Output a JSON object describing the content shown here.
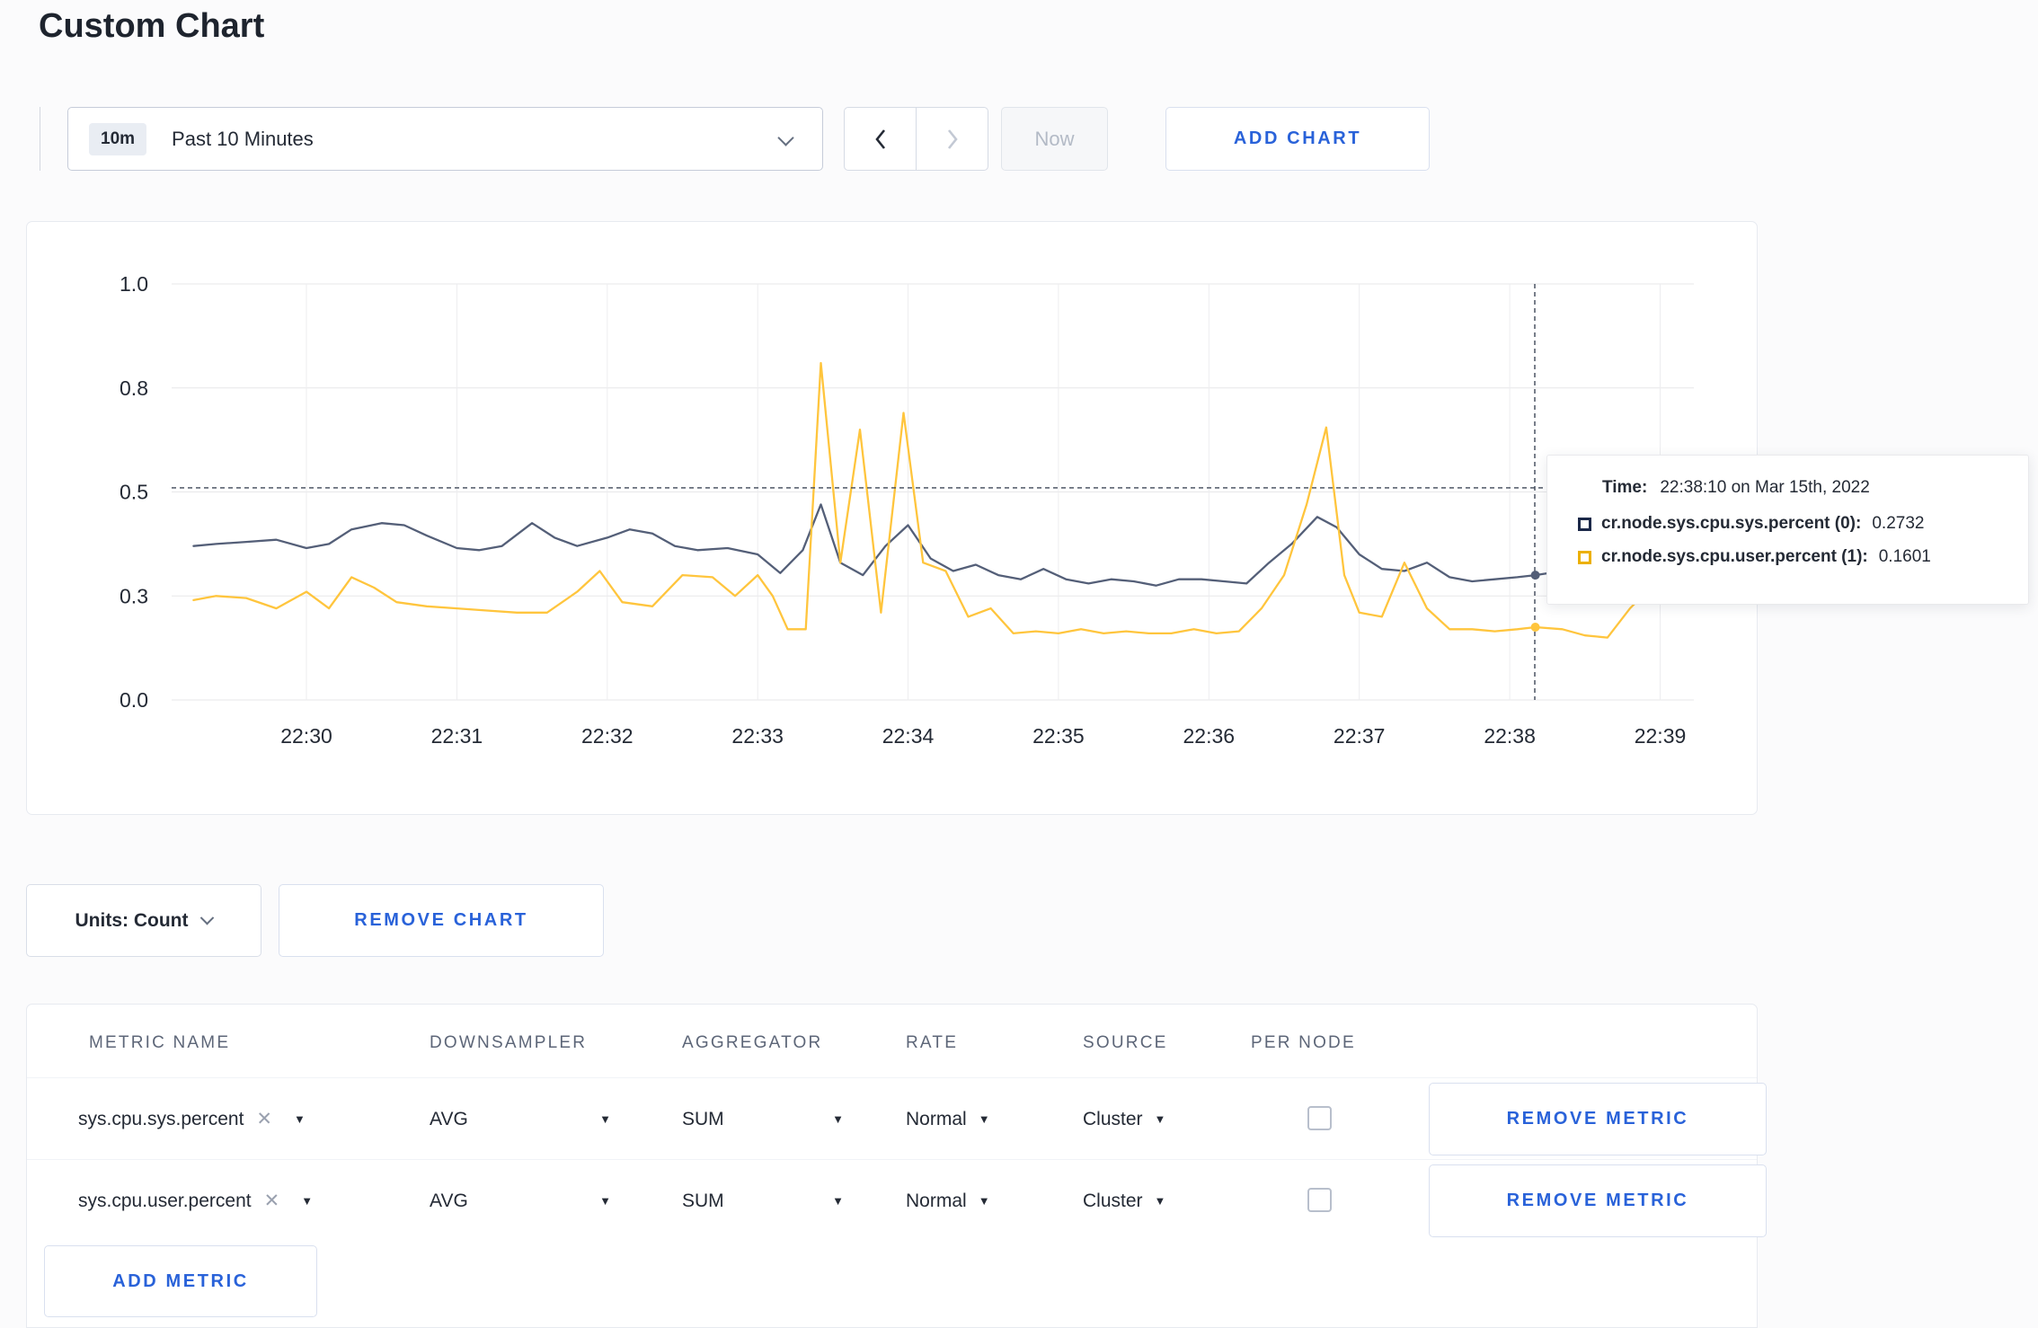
{
  "colors": {
    "accent_blue": "#2962d9",
    "series_sys_line": "#545f78",
    "series_user_line": "#ffc53d",
    "legend_sys_swatch": "#1b2848",
    "legend_user_swatch": "#ecb000"
  },
  "page": {
    "title": "Custom Chart"
  },
  "toolbar": {
    "time_range_badge": "10m",
    "time_range_label": "Past 10 Minutes",
    "now_label": "Now",
    "add_chart_label": "ADD CHART"
  },
  "chart_controls": {
    "units_label": "Units: Count",
    "remove_chart_label": "REMOVE CHART"
  },
  "metrics_table": {
    "headers": [
      "METRIC NAME",
      "DOWNSAMPLER",
      "AGGREGATOR",
      "RATE",
      "SOURCE",
      "PER NODE"
    ],
    "rows": [
      {
        "name": "sys.cpu.sys.percent",
        "remove_x": "✕",
        "downsampler": "AVG",
        "aggregator": "SUM",
        "rate": "Normal",
        "source": "Cluster",
        "per_node_checked": false
      },
      {
        "name": "sys.cpu.user.percent",
        "remove_x": "✕",
        "downsampler": "AVG",
        "aggregator": "SUM",
        "rate": "Normal",
        "source": "Cluster",
        "per_node_checked": false
      }
    ],
    "remove_metric_label": "REMOVE METRIC",
    "add_metric_label": "ADD METRIC"
  },
  "chart_data": {
    "type": "line",
    "title": "",
    "xlabel": "",
    "ylabel": "",
    "ylim": [
      0,
      1
    ],
    "xlim_minutes_after_2200": [
      29.104,
      39.224
    ],
    "grid": true,
    "y_ticks": [
      0,
      0.25,
      0.5,
      0.75,
      1
    ],
    "y_tick_labels": [
      "0.0",
      "0.3",
      "0.5",
      "0.8",
      "1.0"
    ],
    "x_ticks": [
      {
        "x": 30,
        "label": "22:30"
      },
      {
        "x": 31,
        "label": "22:31"
      },
      {
        "x": 32,
        "label": "22:32"
      },
      {
        "x": 33,
        "label": "22:33"
      },
      {
        "x": 34,
        "label": "22:34"
      },
      {
        "x": 35,
        "label": "22:35"
      },
      {
        "x": 36,
        "label": "22:36"
      },
      {
        "x": 37,
        "label": "22:37"
      },
      {
        "x": 38,
        "label": "22:38"
      },
      {
        "x": 39,
        "label": "22:39"
      }
    ],
    "series": [
      {
        "name": "cr.node.sys.cpu.sys.percent",
        "color": "#545f78",
        "points": [
          [
            29.25,
            0.37
          ],
          [
            29.4,
            0.375
          ],
          [
            29.6,
            0.38
          ],
          [
            29.8,
            0.385
          ],
          [
            30.0,
            0.365
          ],
          [
            30.15,
            0.375
          ],
          [
            30.3,
            0.41
          ],
          [
            30.5,
            0.425
          ],
          [
            30.65,
            0.42
          ],
          [
            30.8,
            0.395
          ],
          [
            31.0,
            0.365
          ],
          [
            31.15,
            0.36
          ],
          [
            31.3,
            0.37
          ],
          [
            31.5,
            0.425
          ],
          [
            31.65,
            0.39
          ],
          [
            31.8,
            0.37
          ],
          [
            32.0,
            0.39
          ],
          [
            32.15,
            0.41
          ],
          [
            32.3,
            0.4
          ],
          [
            32.45,
            0.37
          ],
          [
            32.6,
            0.36
          ],
          [
            32.8,
            0.365
          ],
          [
            33.0,
            0.35
          ],
          [
            33.15,
            0.305
          ],
          [
            33.3,
            0.36
          ],
          [
            33.42,
            0.47
          ],
          [
            33.55,
            0.33
          ],
          [
            33.7,
            0.3
          ],
          [
            33.85,
            0.37
          ],
          [
            34.0,
            0.42
          ],
          [
            34.15,
            0.34
          ],
          [
            34.3,
            0.31
          ],
          [
            34.45,
            0.325
          ],
          [
            34.6,
            0.3
          ],
          [
            34.75,
            0.29
          ],
          [
            34.9,
            0.315
          ],
          [
            35.05,
            0.29
          ],
          [
            35.2,
            0.28
          ],
          [
            35.35,
            0.29
          ],
          [
            35.5,
            0.285
          ],
          [
            35.65,
            0.275
          ],
          [
            35.8,
            0.29
          ],
          [
            35.95,
            0.29
          ],
          [
            36.1,
            0.285
          ],
          [
            36.25,
            0.28
          ],
          [
            36.4,
            0.33
          ],
          [
            36.55,
            0.375
          ],
          [
            36.72,
            0.44
          ],
          [
            36.85,
            0.415
          ],
          [
            37.0,
            0.35
          ],
          [
            37.15,
            0.315
          ],
          [
            37.3,
            0.31
          ],
          [
            37.45,
            0.33
          ],
          [
            37.6,
            0.295
          ],
          [
            37.75,
            0.285
          ],
          [
            37.9,
            0.29
          ],
          [
            38.05,
            0.295
          ],
          [
            38.17,
            0.3
          ],
          [
            38.35,
            0.31
          ],
          [
            38.5,
            0.315
          ],
          [
            38.65,
            0.3
          ],
          [
            38.8,
            0.3
          ],
          [
            38.95,
            0.305
          ],
          [
            39.1,
            0.31
          ]
        ]
      },
      {
        "name": "cr.node.sys.cpu.user.percent",
        "color": "#ffc53d",
        "points": [
          [
            29.25,
            0.24
          ],
          [
            29.4,
            0.25
          ],
          [
            29.6,
            0.245
          ],
          [
            29.8,
            0.22
          ],
          [
            30.0,
            0.26
          ],
          [
            30.15,
            0.22
          ],
          [
            30.3,
            0.295
          ],
          [
            30.45,
            0.27
          ],
          [
            30.6,
            0.235
          ],
          [
            30.8,
            0.225
          ],
          [
            31.0,
            0.22
          ],
          [
            31.2,
            0.215
          ],
          [
            31.4,
            0.21
          ],
          [
            31.6,
            0.21
          ],
          [
            31.8,
            0.26
          ],
          [
            31.95,
            0.31
          ],
          [
            32.1,
            0.235
          ],
          [
            32.3,
            0.225
          ],
          [
            32.5,
            0.3
          ],
          [
            32.7,
            0.295
          ],
          [
            32.85,
            0.25
          ],
          [
            33.0,
            0.3
          ],
          [
            33.1,
            0.25
          ],
          [
            33.2,
            0.17
          ],
          [
            33.32,
            0.17
          ],
          [
            33.42,
            0.81
          ],
          [
            33.55,
            0.33
          ],
          [
            33.68,
            0.65
          ],
          [
            33.82,
            0.21
          ],
          [
            33.97,
            0.69
          ],
          [
            34.1,
            0.33
          ],
          [
            34.25,
            0.31
          ],
          [
            34.4,
            0.2
          ],
          [
            34.55,
            0.22
          ],
          [
            34.7,
            0.16
          ],
          [
            34.85,
            0.165
          ],
          [
            35.0,
            0.16
          ],
          [
            35.15,
            0.17
          ],
          [
            35.3,
            0.16
          ],
          [
            35.45,
            0.165
          ],
          [
            35.6,
            0.16
          ],
          [
            35.75,
            0.16
          ],
          [
            35.9,
            0.17
          ],
          [
            36.05,
            0.16
          ],
          [
            36.2,
            0.165
          ],
          [
            36.35,
            0.22
          ],
          [
            36.5,
            0.3
          ],
          [
            36.65,
            0.47
          ],
          [
            36.78,
            0.655
          ],
          [
            36.9,
            0.3
          ],
          [
            37.0,
            0.21
          ],
          [
            37.15,
            0.2
          ],
          [
            37.3,
            0.33
          ],
          [
            37.45,
            0.22
          ],
          [
            37.6,
            0.17
          ],
          [
            37.75,
            0.17
          ],
          [
            37.9,
            0.165
          ],
          [
            38.05,
            0.17
          ],
          [
            38.17,
            0.175
          ],
          [
            38.35,
            0.17
          ],
          [
            38.5,
            0.155
          ],
          [
            38.65,
            0.15
          ],
          [
            38.8,
            0.22
          ],
          [
            38.95,
            0.275
          ],
          [
            39.1,
            0.245
          ]
        ]
      }
    ],
    "crosshair": {
      "x": 38.1667,
      "y": 0.51
    },
    "tooltip": {
      "time_label": "Time:",
      "time_value": "22:38:10 on Mar 15th, 2022",
      "rows": [
        {
          "label": "cr.node.sys.cpu.sys.percent (0):",
          "value": "0.2732"
        },
        {
          "label": "cr.node.sys.cpu.user.percent (1):",
          "value": "0.1601"
        }
      ]
    }
  }
}
